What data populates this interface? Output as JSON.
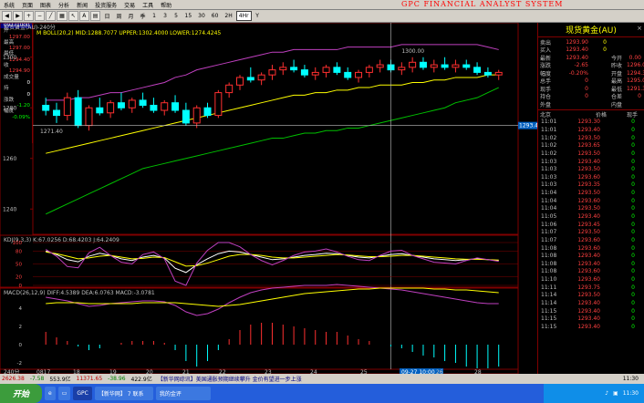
{
  "menu": [
    "系统",
    "页面",
    "图表",
    "分析",
    "新闻",
    "投资服务",
    "交易",
    "工具",
    "帮助"
  ],
  "brand": "GPC FINANCIAL ANALYST SYSTEM",
  "toolbar": [
    "日",
    "周",
    "月",
    "季",
    "1",
    "3",
    "5",
    "15",
    "30",
    "60",
    "2H",
    "4Hr",
    "Y"
  ],
  "toolbar_active": "4Hr",
  "left_info": {
    "date": "09271000",
    "rows": [
      {
        "l": "开",
        "v": "1297.00",
        "c": "r"
      },
      {
        "l": "最高",
        "v": "1297.00",
        "c": "r"
      },
      {
        "l": "最低",
        "v": "1294.40",
        "c": "r"
      },
      {
        "l": "收",
        "v": "1294.90",
        "c": "r"
      },
      {
        "l": "成交量",
        "v": "0",
        "c": "w"
      },
      {
        "l": "持",
        "v": "0",
        "c": "w"
      },
      {
        "l": "涨跌",
        "v": "-1.20",
        "c": "g"
      },
      {
        "l": "幅度",
        "v": "-0.09%",
        "c": "g"
      }
    ]
  },
  "main_header": "现货黄金(AU)-240分",
  "ma_legend": {
    "label": "M  BOLL(20,2) MID:1288.7077 UPPER:1302.4000 LOWER:1274.4245",
    "color": "#ffff00"
  },
  "price_ticks": [
    "1300",
    "1280",
    "1260",
    "1240"
  ],
  "annotations": {
    "high": "1300.00",
    "low": "1271.40"
  },
  "last_price_tag": "1293.40",
  "kdj_legend": "KDJ(9,3,3)  K:67.0256  D:68.4203  J:64.2409",
  "kdj_ticks": [
    "100",
    "80",
    "50",
    "20",
    "0"
  ],
  "macd_legend": "MACD(26,12,9)  DIFF:4.5389  DEA:6.0763  MACD:-3.0781",
  "macd_ticks": [
    "4",
    "2",
    "0",
    "-2"
  ],
  "x_ticks": [
    "240分",
    "0817",
    "18",
    "19",
    "20",
    "21",
    "22",
    "23",
    "24",
    "25",
    "09-27 10:00",
    "26",
    "28"
  ],
  "right_panel": {
    "title": "现货黄金(AU)",
    "quote_rows": [
      {
        "a": "卖出",
        "b": "1293.90",
        "c": "0",
        "d": "",
        "e": ""
      },
      {
        "a": "买入",
        "b": "1293.40",
        "c": "0",
        "d": "",
        "e": ""
      },
      {
        "a": "最新",
        "b": "1293.40",
        "c": "",
        "d": "今开",
        "e": "0.00"
      },
      {
        "a": "涨跌",
        "b": "-2.65",
        "c": "",
        "d": "昨收",
        "e": "1296.05"
      },
      {
        "a": "幅度",
        "b": "-0.20%",
        "c": "",
        "d": "开盘",
        "e": "1294.30"
      },
      {
        "a": "总手",
        "b": "0",
        "c": "",
        "d": "最高",
        "e": "1295.00"
      },
      {
        "a": "现手",
        "b": "0",
        "c": "",
        "d": "最低",
        "e": "1291.30"
      },
      {
        "a": "持仓",
        "b": "0",
        "c": "",
        "d": "仓差",
        "e": "0"
      },
      {
        "a": "外盘",
        "b": "",
        "c": "",
        "d": "内盘",
        "e": ""
      }
    ],
    "trade_header": [
      "北京",
      "价格",
      "现手"
    ],
    "trades": [
      [
        "11:01",
        "1293.30",
        "0"
      ],
      [
        "11:01",
        "1293.40",
        "0"
      ],
      [
        "11:02",
        "1293.50",
        "0"
      ],
      [
        "11:02",
        "1293.65",
        "0"
      ],
      [
        "11:02",
        "1293.50",
        "0"
      ],
      [
        "11:03",
        "1293.40",
        "0"
      ],
      [
        "11:03",
        "1293.50",
        "0"
      ],
      [
        "11:03",
        "1293.60",
        "0"
      ],
      [
        "11:03",
        "1293.35",
        "0"
      ],
      [
        "11:04",
        "1293.50",
        "0"
      ],
      [
        "11:04",
        "1293.60",
        "0"
      ],
      [
        "11:04",
        "1293.50",
        "0"
      ],
      [
        "11:05",
        "1293.40",
        "0"
      ],
      [
        "11:06",
        "1293.45",
        "0"
      ],
      [
        "11:07",
        "1293.50",
        "0"
      ],
      [
        "11:07",
        "1293.60",
        "0"
      ],
      [
        "11:08",
        "1293.60",
        "0"
      ],
      [
        "11:08",
        "1293.40",
        "0"
      ],
      [
        "11:08",
        "1293.40",
        "0"
      ],
      [
        "11:08",
        "1293.60",
        "0"
      ],
      [
        "11:10",
        "1293.60",
        "0"
      ],
      [
        "11:11",
        "1293.75",
        "0"
      ],
      [
        "11:14",
        "1293.50",
        "0"
      ],
      [
        "11:14",
        "1293.40",
        "0"
      ],
      [
        "11:15",
        "1293.40",
        "0"
      ],
      [
        "11:15",
        "1293.40",
        "0"
      ],
      [
        "11:15",
        "1293.40",
        "0"
      ]
    ]
  },
  "status_bar": {
    "a": "2626.38",
    "b": "-7.58",
    "c": "553.9亿",
    "d": "11371.65",
    "e": "-38.96",
    "f": "422.9亿",
    "news": "【新华网综讯】美国通胀预期继续攀升 金价有望进一步上涨",
    "time": "11:30"
  },
  "taskbar": {
    "start": "开始",
    "items": [
      "GPC",
      "【新华网】 7 联系",
      "我的金评"
    ],
    "tray": "11:30"
  },
  "chart_data": {
    "type": "candlestick",
    "periods": 53,
    "ylim": [
      1230,
      1310
    ],
    "candles": [
      [
        1281,
        1284,
        1277,
        1279
      ],
      [
        1279,
        1282,
        1274,
        1277
      ],
      [
        1277,
        1286,
        1275,
        1284
      ],
      [
        1284,
        1287,
        1272,
        1273
      ],
      [
        1273,
        1281,
        1271,
        1280
      ],
      [
        1280,
        1284,
        1277,
        1278
      ],
      [
        1278,
        1283,
        1276,
        1282
      ],
      [
        1282,
        1286,
        1279,
        1280
      ],
      [
        1280,
        1284,
        1278,
        1283
      ],
      [
        1283,
        1286,
        1280,
        1281
      ],
      [
        1281,
        1284,
        1278,
        1279
      ],
      [
        1279,
        1283,
        1277,
        1282
      ],
      [
        1282,
        1285,
        1278,
        1279
      ],
      [
        1279,
        1282,
        1273,
        1274
      ],
      [
        1274,
        1281,
        1272,
        1280
      ],
      [
        1280,
        1282,
        1276,
        1277
      ],
      [
        1277,
        1287,
        1276,
        1286
      ],
      [
        1286,
        1290,
        1284,
        1289
      ],
      [
        1289,
        1293,
        1287,
        1292
      ],
      [
        1292,
        1296,
        1290,
        1291
      ],
      [
        1291,
        1294,
        1289,
        1293
      ],
      [
        1293,
        1297,
        1291,
        1295
      ],
      [
        1295,
        1298,
        1293,
        1296
      ],
      [
        1296,
        1299,
        1294,
        1295
      ],
      [
        1295,
        1297,
        1292,
        1293
      ],
      [
        1293,
        1296,
        1291,
        1294
      ],
      [
        1294,
        1297,
        1292,
        1296
      ],
      [
        1296,
        1298,
        1293,
        1294
      ],
      [
        1294,
        1296,
        1291,
        1292
      ],
      [
        1292,
        1295,
        1290,
        1294
      ],
      [
        1294,
        1297,
        1292,
        1296
      ],
      [
        1296,
        1299,
        1294,
        1297
      ],
      [
        1297,
        1299,
        1294,
        1295
      ],
      [
        1295,
        1298,
        1293,
        1296
      ],
      [
        1296,
        1300,
        1294,
        1298
      ],
      [
        1298,
        1300,
        1295,
        1296
      ],
      [
        1296,
        1299,
        1294,
        1297
      ],
      [
        1297,
        1300,
        1295,
        1296
      ],
      [
        1296,
        1299,
        1294,
        1297
      ],
      [
        1297,
        1299,
        1295,
        1296
      ],
      [
        1296,
        1298,
        1293,
        1294
      ],
      [
        1294,
        1296,
        1292,
        1293
      ],
      [
        1293,
        1295,
        1291,
        1294
      ]
    ],
    "boll_upper": [
      1283,
      1283,
      1283,
      1284,
      1284,
      1285,
      1286,
      1286,
      1287,
      1288,
      1289,
      1290,
      1292,
      1293,
      1295,
      1296,
      1297,
      1298,
      1299,
      1300,
      1301,
      1302,
      1302,
      1303,
      1303,
      1303,
      1303,
      1303,
      1304,
      1304,
      1304,
      1304,
      1304,
      1305,
      1305,
      1305,
      1305,
      1305,
      1305,
      1305,
      1305,
      1304,
      1303
    ],
    "boll_mid": [
      1262,
      1263,
      1264,
      1265,
      1266,
      1267,
      1268,
      1269,
      1270,
      1271,
      1272,
      1273,
      1274,
      1275,
      1276,
      1277,
      1278,
      1279,
      1280,
      1281,
      1282,
      1283,
      1284,
      1285,
      1285,
      1286,
      1286,
      1287,
      1287,
      1288,
      1288,
      1289,
      1289,
      1289,
      1290,
      1290,
      1291,
      1291,
      1292,
      1292,
      1292,
      1293,
      1293
    ],
    "boll_lower": [
      1238,
      1240,
      1242,
      1244,
      1246,
      1248,
      1250,
      1252,
      1254,
      1256,
      1257,
      1258,
      1259,
      1260,
      1261,
      1262,
      1263,
      1264,
      1265,
      1266,
      1267,
      1268,
      1268,
      1269,
      1270,
      1270,
      1271,
      1271,
      1272,
      1272,
      1273,
      1274,
      1275,
      1276,
      1277,
      1278,
      1279,
      1280,
      1282,
      1283,
      1284,
      1286,
      1288
    ],
    "kdj": {
      "K": [
        80,
        72,
        60,
        55,
        68,
        75,
        70,
        62,
        58,
        66,
        70,
        64,
        40,
        30,
        48,
        62,
        74,
        80,
        78,
        72,
        66,
        60,
        62,
        66,
        70,
        72,
        75,
        74,
        70,
        66,
        64,
        68,
        72,
        74,
        70,
        66,
        62,
        60,
        58,
        60,
        62,
        60,
        58
      ],
      "D": [
        78,
        74,
        68,
        62,
        64,
        68,
        70,
        66,
        62,
        63,
        66,
        65,
        55,
        45,
        46,
        52,
        60,
        68,
        72,
        72,
        70,
        66,
        64,
        64,
        66,
        68,
        70,
        72,
        71,
        69,
        67,
        67,
        68,
        70,
        70,
        68,
        66,
        64,
        62,
        61,
        61,
        60,
        59
      ],
      "J": [
        84,
        68,
        44,
        41,
        76,
        89,
        70,
        54,
        50,
        72,
        78,
        62,
        10,
        0,
        52,
        82,
        100,
        100,
        90,
        72,
        58,
        48,
        58,
        70,
        78,
        80,
        85,
        78,
        68,
        60,
        58,
        70,
        80,
        82,
        70,
        62,
        54,
        52,
        50,
        58,
        64,
        60,
        56
      ]
    },
    "macd": {
      "DIFF": [
        5.2,
        5.0,
        4.8,
        4.5,
        4.2,
        4.3,
        4.5,
        4.6,
        4.7,
        4.8,
        4.8,
        4.7,
        4.3,
        3.6,
        3.2,
        3.4,
        3.9,
        4.6,
        5.2,
        5.7,
        6.0,
        6.2,
        6.3,
        6.4,
        6.5,
        6.5,
        6.5,
        6.6,
        6.5,
        6.4,
        6.3,
        6.2,
        6.1,
        6.0,
        5.8,
        5.6,
        5.4,
        5.2,
        5.0,
        4.8,
        4.6,
        4.5,
        4.5
      ],
      "DEA": [
        4.5,
        4.6,
        4.6,
        4.6,
        4.5,
        4.5,
        4.5,
        4.5,
        4.5,
        4.6,
        4.6,
        4.6,
        4.6,
        4.5,
        4.4,
        4.3,
        4.2,
        4.3,
        4.4,
        4.6,
        4.8,
        5.0,
        5.2,
        5.4,
        5.6,
        5.7,
        5.8,
        5.9,
        6.0,
        6.1,
        6.1,
        6.2,
        6.2,
        6.2,
        6.2,
        6.2,
        6.1,
        6.1,
        6.0,
        6.0,
        5.9,
        5.8,
        5.7
      ],
      "HIST": [
        1.4,
        0.8,
        0.4,
        -0.2,
        -0.6,
        -0.4,
        0,
        0.2,
        0.4,
        0.4,
        0.4,
        0.2,
        -0.6,
        -1.8,
        -2.4,
        -1.8,
        -0.6,
        0.6,
        1.6,
        2.2,
        2.4,
        2.4,
        2.2,
        2.0,
        1.8,
        1.6,
        1.4,
        1.4,
        1.0,
        0.6,
        0.4,
        0,
        -0.2,
        -0.4,
        -0.8,
        -1.2,
        -1.4,
        -1.8,
        -2.0,
        -2.4,
        -2.6,
        -2.6,
        -2.4
      ]
    }
  }
}
